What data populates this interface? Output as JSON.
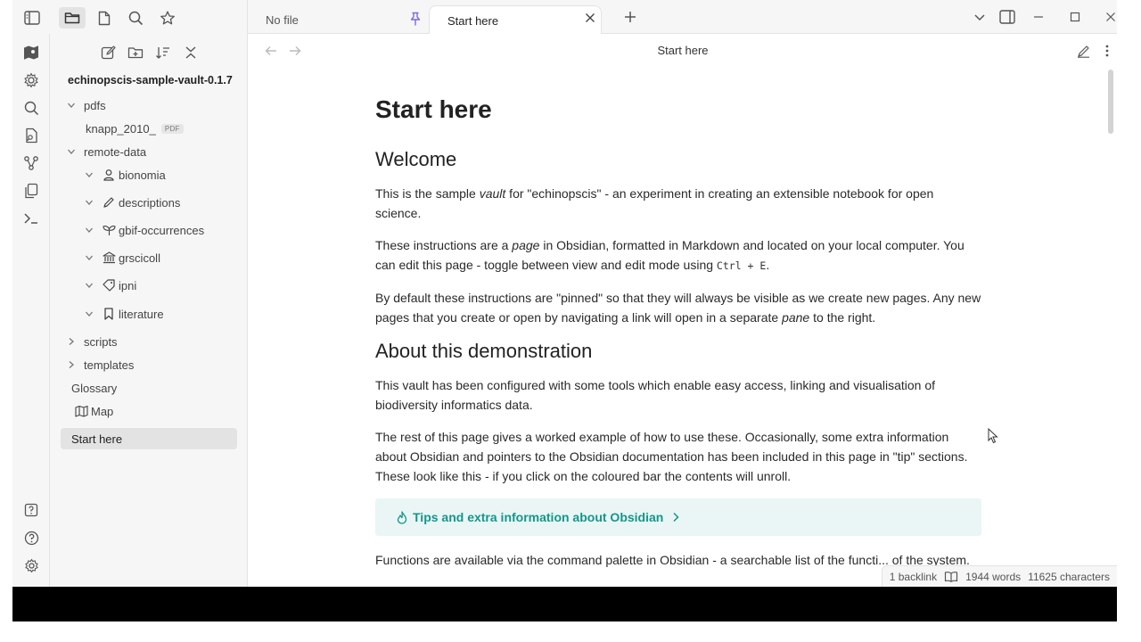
{
  "tabs": [
    {
      "label": "No file"
    },
    {
      "label": "Start here"
    }
  ],
  "view_header": {
    "title": "Start here"
  },
  "vault": {
    "name": "echinopscis-sample-vault-0.1.7"
  },
  "tree": [
    {
      "label": "pdfs"
    },
    {
      "label": "knapp_2010_",
      "badge": "PDF"
    },
    {
      "label": "remote-data"
    },
    {
      "label": "bionomia"
    },
    {
      "label": "descriptions"
    },
    {
      "label": "gbif-occurrences"
    },
    {
      "label": "grscicoll"
    },
    {
      "label": "ipni"
    },
    {
      "label": "literature"
    },
    {
      "label": "scripts"
    },
    {
      "label": "templates"
    },
    {
      "label": "Glossary"
    },
    {
      "label": "Map"
    },
    {
      "label": "Start here"
    }
  ],
  "content": {
    "h1": "Start here",
    "h2_welcome": "Welcome",
    "p1": {
      "a": "This is the sample ",
      "em": "vault",
      "b": " for \"echinopscis\" - an experiment in creating an extensible notebook for open science."
    },
    "p2": {
      "a": "These instructions are a ",
      "em": "page",
      "b": " in Obsidian, formatted in Markdown and located on your local computer. You can edit this page - toggle between view and edit mode using ",
      "code": "Ctrl + E",
      "c": "."
    },
    "p3": {
      "a": "By default these instructions are \"pinned\" so that they will always be visible as we create new pages. Any new pages that you create or open by navigating a link will open in a separate ",
      "em": "pane",
      "b": " to the right."
    },
    "h2_about": "About this demonstration",
    "p4": "This vault has been configured with some tools which enable easy access, linking and visualisation of biodiversity informatics data.",
    "p5": "The rest of this page gives a worked example of how to use these. Occasionally, some extra information about Obsidian and pointers to the Obsidian documentation has been included in this page in \"tip\" sections. These look like this - if you click on the coloured bar the contents will unroll.",
    "callout": "Tips and extra information about Obsidian",
    "p6": "Functions are available via the command palette in Obsidian - a searchable list of the functi... of the system."
  },
  "status": {
    "backlinks": "1 backlink",
    "words": "1944 words",
    "characters": "11625 characters"
  },
  "colors": {
    "accent": "#16958a",
    "callout_bg": "#e9f6f5",
    "panel": "#f6f6f6"
  }
}
